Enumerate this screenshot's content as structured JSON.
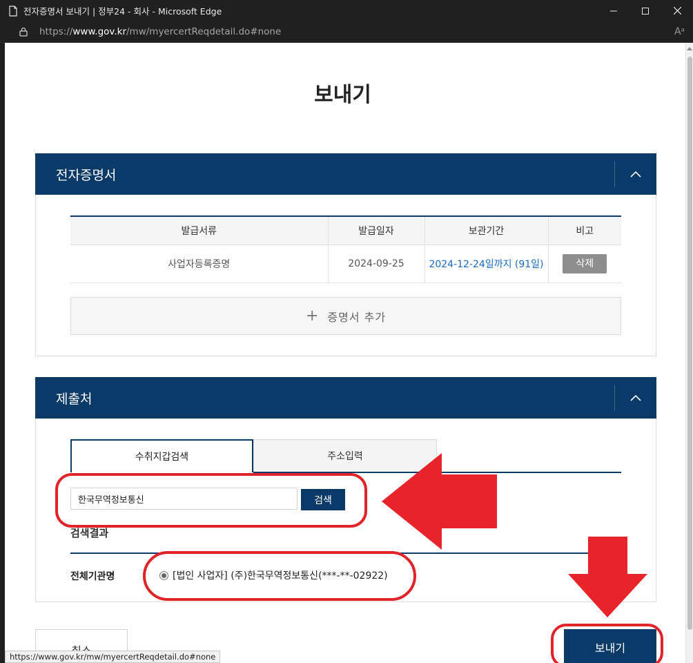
{
  "window": {
    "title": "전자증명서 보내기 | 정부24 - 회사 - Microsoft Edge",
    "url_prefix": "https://",
    "url_domain": "www.gov.kr",
    "url_path": "/mw/myercertReqdetail.do#none",
    "reader_icon": "A"
  },
  "page": {
    "title": "보내기"
  },
  "certificates": {
    "section_title": "전자증명서",
    "headers": [
      "발급서류",
      "발급일자",
      "보관기간",
      "비고"
    ],
    "rows": [
      {
        "document": "사업자등록증명",
        "issue_date": "2024-09-25",
        "retention": "2024-12-24일까지 (91일)",
        "action": "삭제"
      }
    ],
    "add_label": "증명서 추가"
  },
  "submitter": {
    "section_title": "제출처",
    "tabs": [
      "수취지갑검색",
      "주소입력"
    ],
    "search_value": "한국무역정보통신",
    "search_button": "검색",
    "results_title": "검색결과",
    "org_label": "전체기관명",
    "org_option": "[법인 사업자] (주)한국무역정보통신(***-**-02922)"
  },
  "footer": {
    "cancel_label": "취소",
    "send_label": "보내기",
    "status_url": "https://www.gov.kr/mw/myercertReqdetail.do#none"
  },
  "colors": {
    "navy": "#0b3a68",
    "annotation_red": "#e0242a",
    "link_blue": "#1a6ac4"
  }
}
